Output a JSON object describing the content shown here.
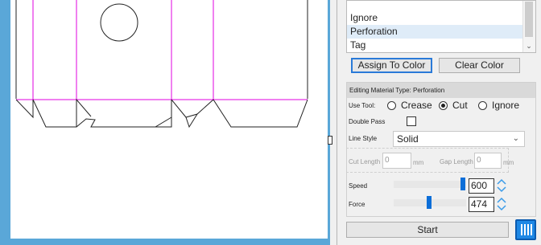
{
  "material_types": {
    "items": [
      "Ignore",
      "Perforation",
      "Tag"
    ],
    "selected": "Perforation"
  },
  "color_actions": {
    "assign_label": "Assign To Color",
    "clear_label": "Clear Color"
  },
  "editing": {
    "header": "Editing  Material Type: Perforation",
    "use_tool_label": "Use Tool:",
    "tool_options": [
      "Crease",
      "Cut",
      "Ignore"
    ],
    "tool_selected": "Cut",
    "double_pass_label": "Double Pass",
    "double_pass_checked": false,
    "line_style_label": "Line Style",
    "line_style_value": "Solid",
    "cut_length_label": "Cut Length",
    "cut_length_value": "0",
    "gap_length_label": "Gap Length",
    "gap_length_value": "0",
    "unit": "mm",
    "speed_label": "Speed",
    "speed_value": "600",
    "force_label": "Force",
    "force_value": "474"
  },
  "start_label": "Start",
  "colors": {
    "accent": "#0c6ed8",
    "canvas_border": "#5aa7d8",
    "crease_line": "#e000e0",
    "cut_line": "#222222"
  },
  "icons": {
    "columns_button": "columns-icon",
    "scroll_down": "chevron-down-icon",
    "dropdown": "chevron-down-icon",
    "stepper": "up-down-arrows-icon"
  }
}
